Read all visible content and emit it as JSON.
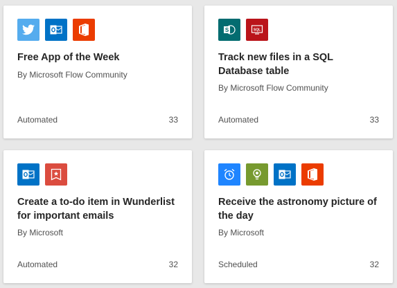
{
  "cards": [
    {
      "title": "Free App of the Week",
      "author": "By Microsoft Flow Community",
      "type": "Automated",
      "count": "33",
      "icons": [
        {
          "name": "twitter-icon",
          "color": "#55acee"
        },
        {
          "name": "outlook-icon",
          "color": "#0072c6"
        },
        {
          "name": "office365-icon",
          "color": "#eb3c00"
        }
      ]
    },
    {
      "title": "Track new files in a SQL Database table",
      "author": "By Microsoft Flow Community",
      "type": "Automated",
      "count": "33",
      "icons": [
        {
          "name": "sharepoint-icon",
          "color": "#036c70"
        },
        {
          "name": "sql-database-icon",
          "color": "#ba141a"
        }
      ]
    },
    {
      "title": "Create a to-do item in Wunderlist for important emails",
      "author": "By Microsoft",
      "type": "Automated",
      "count": "32",
      "icons": [
        {
          "name": "outlook-icon",
          "color": "#0072c6"
        },
        {
          "name": "wunderlist-icon",
          "color": "#db4c3f"
        }
      ]
    },
    {
      "title": "Receive the astronomy picture of the day",
      "author": "By Microsoft",
      "type": "Scheduled",
      "count": "32",
      "icons": [
        {
          "name": "alarm-clock-icon",
          "color": "#1f85ff"
        },
        {
          "name": "lightbulb-icon",
          "color": "#779a2f"
        },
        {
          "name": "outlook-icon",
          "color": "#0072c6"
        },
        {
          "name": "office365-icon",
          "color": "#eb3c00"
        }
      ]
    }
  ]
}
